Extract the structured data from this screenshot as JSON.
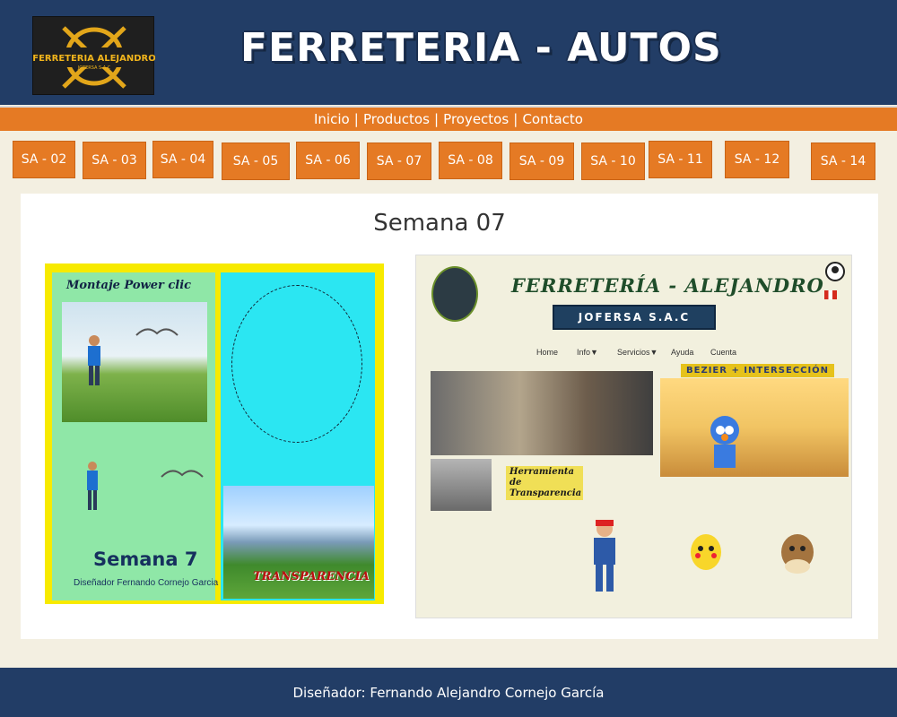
{
  "header": {
    "logo_text": "FERRETERIA ALEJANDRO",
    "logo_subtext": "JOFERSA S.A.C",
    "title": "FERRETERIA - AUTOS"
  },
  "nav": {
    "items": [
      "Inicio",
      "Productos",
      "Proyectos",
      "Contacto"
    ],
    "separator": "|"
  },
  "weeks": [
    "SA - 02",
    "SA - 03",
    "SA - 04",
    "SA - 05",
    "SA - 06",
    "SA - 07",
    "SA - 08",
    "SA - 09",
    "SA - 10",
    "SA - 11",
    "SA - 12",
    "SA - 14"
  ],
  "main": {
    "section_title": "Semana 07"
  },
  "left_preview": {
    "heading": "Montaje Power clic",
    "big_title": "Semana 7",
    "designer": "Diseñador Fernando Cornejo Garcia",
    "banner": "TRANSPARENCIA"
  },
  "right_preview": {
    "title": "FERRETERÍA - ALEJANDRO",
    "subtitle": "JOFERSA S.A.C",
    "menu": [
      "Home",
      "Info▼",
      "Servicios▼",
      "Ayuda",
      "Cuenta"
    ],
    "tag_bezier": "BEZIER + INTERSECCIÓN",
    "tag_tool": "Herramienta de Transparencia"
  },
  "footer": {
    "credit": "Diseñador: Fernando Alejandro Cornejo García"
  },
  "colors": {
    "header_bg": "#223d66",
    "accent_orange": "#e57a24",
    "page_bg": "#f3efe1"
  }
}
